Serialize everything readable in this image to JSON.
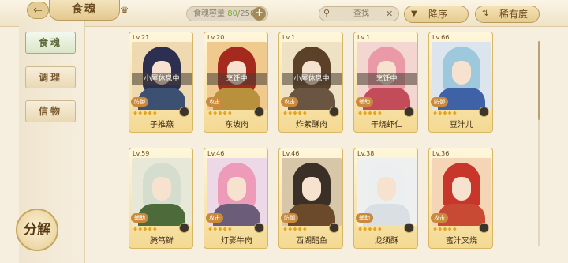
{
  "header": {
    "back_glyph": "⇐",
    "title": "食魂",
    "crown_glyph": "♛",
    "capacity_label": "食魂容量 ",
    "capacity_current": "80",
    "capacity_max": "/250",
    "plus_glyph": "+",
    "search_placeholder": "查找",
    "sort_label": "降序",
    "rarity_label": "稀有度"
  },
  "sidebar": {
    "tabs": [
      {
        "label": "食魂",
        "active": true
      },
      {
        "label": "调理",
        "active": false
      },
      {
        "label": "信物",
        "active": false
      }
    ],
    "decompose_label": "分解"
  },
  "cards": [
    {
      "level": "Lv.21",
      "name": "子推燕",
      "status": "小屋休息中",
      "tag": "防御",
      "hair": "#2c2f4f",
      "outfit": "#3c5072"
    },
    {
      "level": "Lv.20",
      "name": "东坡肉",
      "status": "烹饪中",
      "tag": "攻击",
      "hair": "#a42a1e",
      "outfit": "#b9913d"
    },
    {
      "level": "Lv.1",
      "name": "炸紫酥肉",
      "status": "小屋休息中",
      "tag": "攻击",
      "hair": "#5a4128",
      "outfit": "#6a5542"
    },
    {
      "level": "Lv.1",
      "name": "干烧虾仁",
      "status": "烹饪中",
      "tag": "辅助",
      "hair": "#e99aa6",
      "outfit": "#c24c5a"
    },
    {
      "level": "Lv.66",
      "name": "豆汁儿",
      "status": "",
      "tag": "防御",
      "hair": "#9ec8dc",
      "outfit": "#3f62a6"
    },
    {
      "level": "Lv.59",
      "name": "腌笃鲜",
      "status": "",
      "tag": "辅助",
      "hair": "#d5ddcf",
      "outfit": "#4d6a3a"
    },
    {
      "level": "Lv.46",
      "name": "灯影牛肉",
      "status": "",
      "tag": "攻击",
      "hair": "#ee9bb9",
      "outfit": "#6b5d7a"
    },
    {
      "level": "Lv.46",
      "name": "西湖醋鱼",
      "status": "",
      "tag": "防御",
      "hair": "#3a3028",
      "outfit": "#6a4a2a"
    },
    {
      "level": "Lv.38",
      "name": "龙须酥",
      "status": "",
      "tag": "辅助",
      "hair": "#eceff0",
      "outfit": "#d9dfe3"
    },
    {
      "level": "Lv.36",
      "name": "蜜汁叉烧",
      "status": "",
      "tag": "攻击",
      "hair": "#c8352a",
      "outfit": "#c94a34"
    }
  ],
  "card_bg": [
    "#eed9b0",
    "#f0c98f",
    "#efe1c3",
    "#f3d6cf",
    "#dce5ee",
    "#e8e8d8",
    "#ecd8e6",
    "#d7c6a8",
    "#eef0f0",
    "#f4d6b6"
  ],
  "stars": "♦♦♦♦♦",
  "card_badge_icon": "element-badge-icon"
}
